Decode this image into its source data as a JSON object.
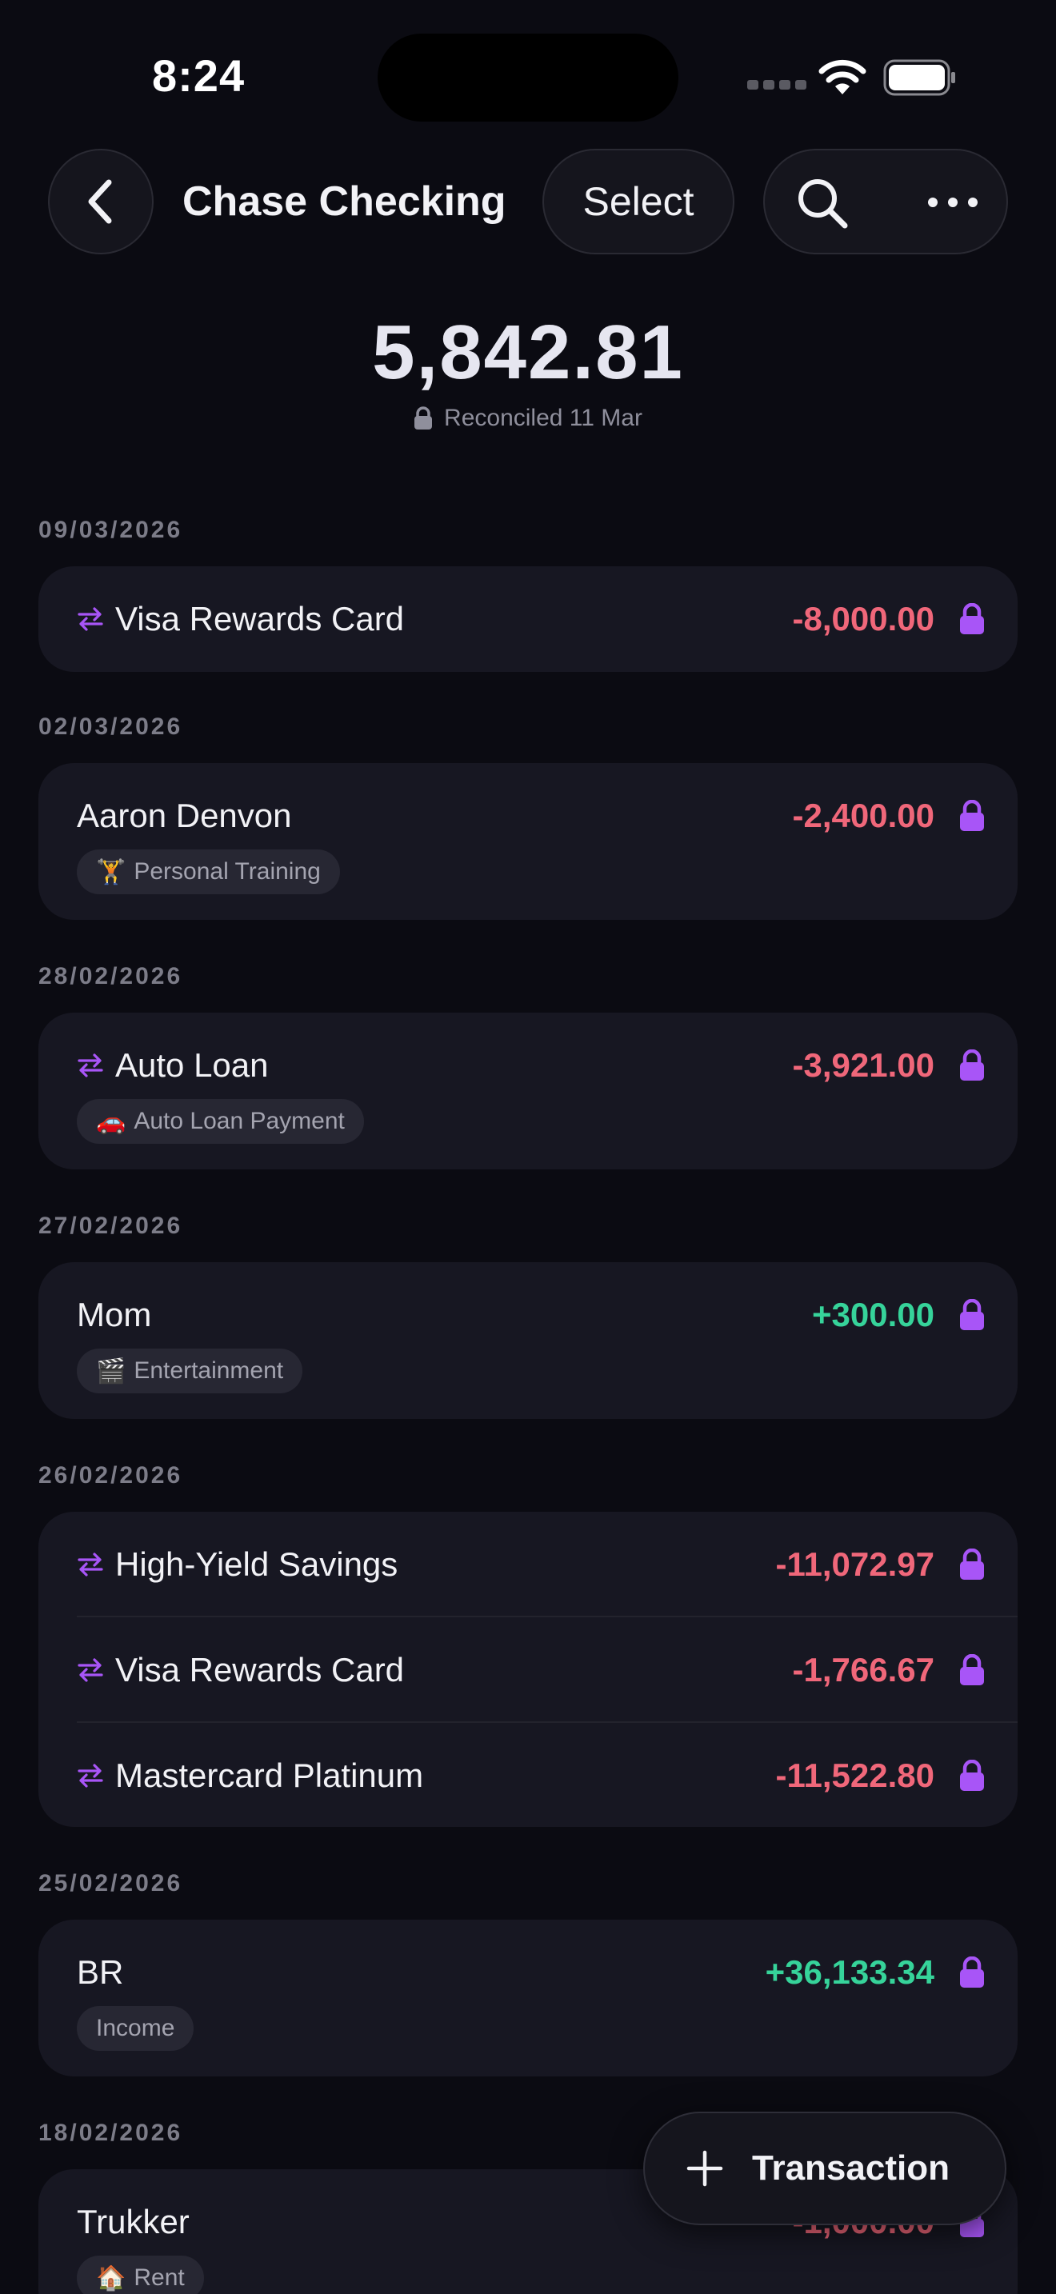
{
  "status_bar": {
    "time": "8:24"
  },
  "nav": {
    "title": "Chase Checking",
    "select_label": "Select"
  },
  "balance": {
    "amount": "5,842.81",
    "reconciled": "Reconciled 11 Mar"
  },
  "groups": [
    {
      "date": "09/03/2026",
      "rows": [
        {
          "name": "Visa Rewards Card",
          "amount": "-8,000.00",
          "transfer": true
        }
      ]
    },
    {
      "date": "02/03/2026",
      "rows": [
        {
          "name": "Aaron Denvon",
          "amount": "-2,400.00",
          "category": "Personal Training",
          "category_icon": "🏋"
        }
      ]
    },
    {
      "date": "28/02/2026",
      "rows": [
        {
          "name": "Auto Loan",
          "amount": "-3,921.00",
          "transfer": true,
          "category": "Auto Loan Payment",
          "category_icon": "🚗"
        }
      ]
    },
    {
      "date": "27/02/2026",
      "rows": [
        {
          "name": "Mom",
          "amount": "+300.00",
          "category": "Entertainment",
          "category_icon": "🎬"
        }
      ]
    },
    {
      "date": "26/02/2026",
      "rows": [
        {
          "name": "High-Yield Savings",
          "amount": "-11,072.97",
          "transfer": true
        },
        {
          "name": "Visa Rewards Card",
          "amount": "-1,766.67",
          "transfer": true
        },
        {
          "name": "Mastercard Platinum",
          "amount": "-11,522.80",
          "transfer": true
        }
      ]
    },
    {
      "date": "25/02/2026",
      "rows": [
        {
          "name": "BR",
          "amount": "+36,133.34",
          "category": "Income"
        }
      ]
    },
    {
      "date": "18/02/2026",
      "rows": [
        {
          "name": "Trukker",
          "amount": "-1,000.00",
          "category": "Rent",
          "category_icon": "🏠"
        }
      ]
    }
  ],
  "fab": {
    "label": "Transaction"
  },
  "colors": {
    "background": "#0b0b12",
    "card": "#171722",
    "negative": "#f0677a",
    "positive": "#36d39a",
    "accent": "#a855f7"
  },
  "icons": [
    "back-chevron-icon",
    "search-icon",
    "more-icon",
    "lock-icon",
    "transfer-icon",
    "plus-icon",
    "wifi-icon",
    "battery-icon"
  ]
}
